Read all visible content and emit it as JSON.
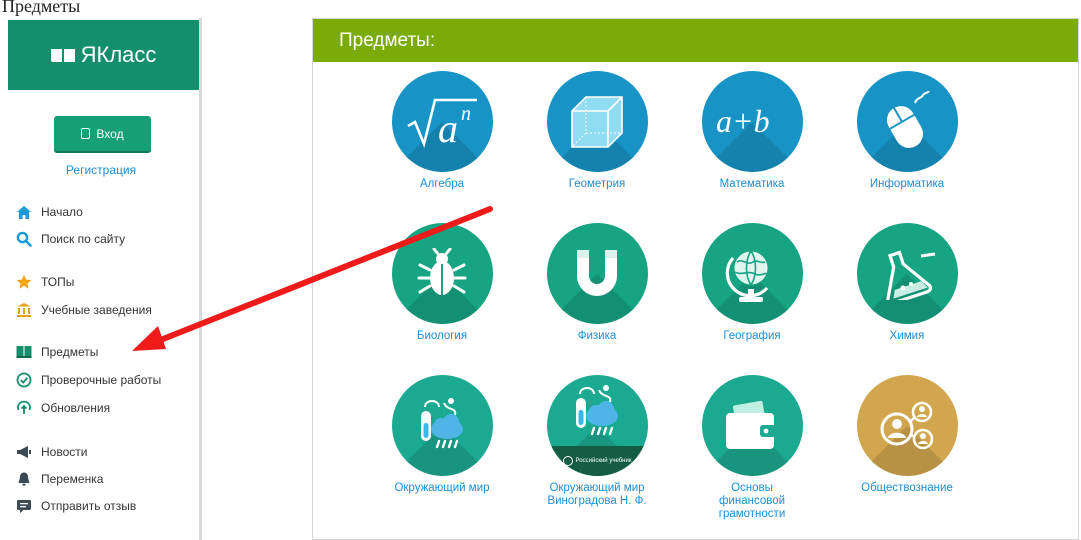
{
  "caption": "Предметы",
  "sidebar": {
    "logo_text": "ЯКласс",
    "login_label": "Вход",
    "register_label": "Регистрация",
    "items": [
      {
        "label": "Начало",
        "icon": "home-icon"
      },
      {
        "label": "Поиск по сайту",
        "icon": "search-icon"
      },
      {
        "label": "ТОПы",
        "icon": "star-icon"
      },
      {
        "label": "Учебные заведения",
        "icon": "building-icon"
      },
      {
        "label": "Предметы",
        "icon": "book-icon"
      },
      {
        "label": "Проверочные работы",
        "icon": "check-circle-icon"
      },
      {
        "label": "Обновления",
        "icon": "update-icon"
      },
      {
        "label": "Новости",
        "icon": "megaphone-icon"
      },
      {
        "label": "Переменка",
        "icon": "bell-icon"
      },
      {
        "label": "Отправить отзыв",
        "icon": "chat-icon"
      }
    ]
  },
  "main": {
    "title": "Предметы:",
    "subjects": [
      {
        "label": "Алгебра",
        "icon": "sqrt-icon",
        "color": "#1794c5"
      },
      {
        "label": "Геометрия",
        "icon": "cube-icon",
        "color": "#1794c5"
      },
      {
        "label": "Математика",
        "icon": "a-plus-b-icon",
        "color": "#1794c5"
      },
      {
        "label": "Информатика",
        "icon": "mouse-icon",
        "color": "#1794c5"
      },
      {
        "label": "Биология",
        "icon": "bug-icon",
        "color": "#16a483"
      },
      {
        "label": "Физика",
        "icon": "magnet-icon",
        "color": "#16a483"
      },
      {
        "label": "География",
        "icon": "globe-icon",
        "color": "#16a483"
      },
      {
        "label": "Химия",
        "icon": "flask-icon",
        "color": "#16a483"
      },
      {
        "label": "Окружающий мир",
        "icon": "weather-icon",
        "color": "#1ca991"
      },
      {
        "label": "Окружающий мир Виноградова Н. Ф.",
        "icon": "weather-icon",
        "color": "#1ca991"
      },
      {
        "label": "Основы финансовой грамотности",
        "icon": "wallet-icon",
        "color": "#1ca991"
      },
      {
        "label": "Обществознание",
        "icon": "people-icon",
        "color": "#d1a64e"
      }
    ],
    "publisher_badge": "Российский учебник"
  },
  "colors": {
    "header_green": "#7bab06",
    "logo_green": "#148f6b",
    "link_blue": "#1a8ed6",
    "arrow_red": "#ef1b1b"
  }
}
